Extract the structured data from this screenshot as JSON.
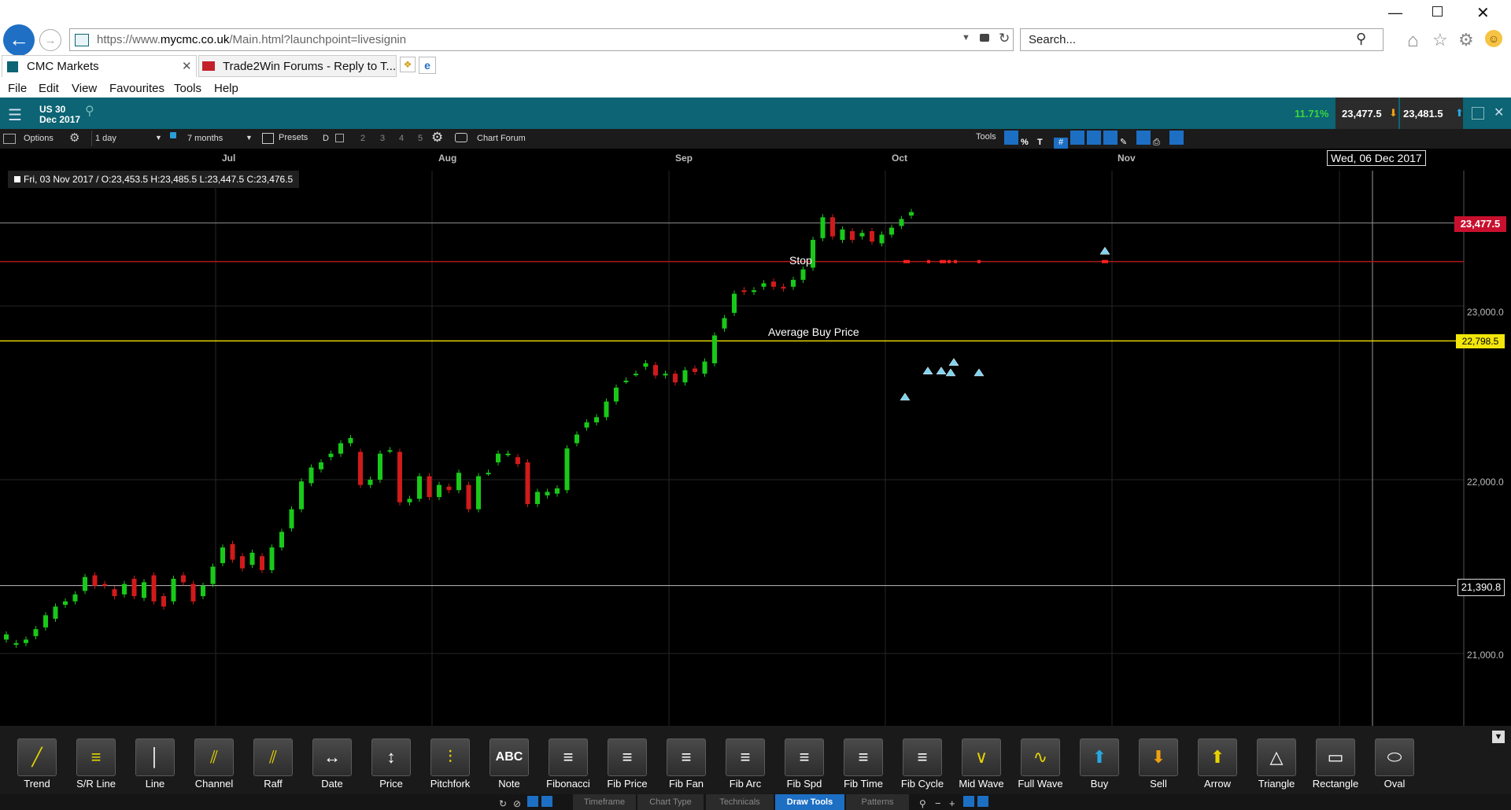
{
  "browser": {
    "url_prefix": "https://www.",
    "url_domain": "mycmc.co.uk",
    "url_path": "/Main.html?launchpoint=livesignin",
    "search_placeholder": "Search...",
    "tabs": [
      {
        "title": "CMC Markets",
        "active": true
      },
      {
        "title": "Trade2Win Forums - Reply to T...",
        "active": false
      }
    ],
    "menu": [
      "File",
      "Edit",
      "View",
      "Favourites",
      "Tools",
      "Help"
    ]
  },
  "instrument": {
    "name": "US 30",
    "expiry": "Dec 2017",
    "change_pct": "11.71%",
    "sell_price": "23,477.5",
    "buy_price": "23,481.5"
  },
  "options_bar": {
    "options_label": "Options",
    "interval": "1 day",
    "range": "7 months",
    "presets_label": "Presets",
    "d_label": "D",
    "preset_nums": [
      "2",
      "3",
      "4",
      "5"
    ],
    "chart_forum_label": "Chart Forum",
    "tools_label": "Tools"
  },
  "chart": {
    "months": [
      "Jul",
      "Aug",
      "Sep",
      "Oct",
      "Nov"
    ],
    "crosshair_date": "Wed, 06 Dec 2017",
    "ohlc_label": "Fri, 03 Nov 2017 / O:23,453.5  H:23,485.5  L:23,447.5  C:23,476.5",
    "price_ticks": [
      "23,000.0",
      "22,000.0",
      "21,000.0"
    ],
    "current_price_label": "23,477.5",
    "avg_price_label": "22,798.5",
    "cursor_price_label": "21,390.8",
    "stop_label": "Stop",
    "avg_label": "Average Buy Price",
    "colors": {
      "up": "#19c919",
      "down": "#d11a1a",
      "avg": "#e6d300",
      "stop": "#b01919",
      "current": "#c8102e"
    }
  },
  "chart_data": {
    "type": "candlestick",
    "ylim": [
      20600,
      23900
    ],
    "avg_buy": 22798.5,
    "stop": 23255,
    "current": 23477.5,
    "cursor": 21390.8,
    "candles": [
      [
        21080,
        21110
      ],
      [
        21050,
        21060
      ],
      [
        21060,
        21080
      ],
      [
        21100,
        21140
      ],
      [
        21150,
        21220
      ],
      [
        21200,
        21270
      ],
      [
        21280,
        21300
      ],
      [
        21300,
        21340
      ],
      [
        21360,
        21440
      ],
      [
        21450,
        21390
      ],
      [
        21400,
        21390
      ],
      [
        21370,
        21330
      ],
      [
        21340,
        21400
      ],
      [
        21430,
        21330
      ],
      [
        21320,
        21410
      ],
      [
        21450,
        21300
      ],
      [
        21330,
        21270
      ],
      [
        21300,
        21430
      ],
      [
        21450,
        21410
      ],
      [
        21400,
        21300
      ],
      [
        21330,
        21390
      ],
      [
        21400,
        21500
      ],
      [
        21520,
        21610
      ],
      [
        21630,
        21540
      ],
      [
        21560,
        21490
      ],
      [
        21510,
        21580
      ],
      [
        21560,
        21480
      ],
      [
        21480,
        21610
      ],
      [
        21610,
        21700
      ],
      [
        21720,
        21830
      ],
      [
        21830,
        21990
      ],
      [
        21980,
        22070
      ],
      [
        22060,
        22100
      ],
      [
        22130,
        22150
      ],
      [
        22150,
        22210
      ],
      [
        22210,
        22240
      ],
      [
        22160,
        21970
      ],
      [
        21970,
        22000
      ],
      [
        22000,
        22150
      ],
      [
        22170,
        22170
      ],
      [
        22160,
        21870
      ],
      [
        21870,
        21890
      ],
      [
        21890,
        22020
      ],
      [
        22020,
        21900
      ],
      [
        21900,
        21970
      ],
      [
        21960,
        21940
      ],
      [
        21940,
        22040
      ],
      [
        21970,
        21830
      ],
      [
        21830,
        22020
      ],
      [
        22040,
        22040
      ],
      [
        22100,
        22150
      ],
      [
        22150,
        22150
      ],
      [
        22130,
        22090
      ],
      [
        22100,
        21860
      ],
      [
        21860,
        21930
      ],
      [
        21910,
        21930
      ],
      [
        21920,
        21950
      ],
      [
        21940,
        22180
      ],
      [
        22210,
        22260
      ],
      [
        22300,
        22330
      ],
      [
        22330,
        22360
      ],
      [
        22360,
        22450
      ],
      [
        22450,
        22530
      ],
      [
        22570,
        22570
      ],
      [
        22610,
        22610
      ],
      [
        22650,
        22670
      ],
      [
        22660,
        22600
      ],
      [
        22600,
        22610
      ],
      [
        22610,
        22560
      ],
      [
        22560,
        22630
      ],
      [
        22640,
        22620
      ],
      [
        22610,
        22680
      ],
      [
        22670,
        22830
      ],
      [
        22870,
        22930
      ],
      [
        22960,
        23070
      ],
      [
        23090,
        23080
      ],
      [
        23080,
        23090
      ],
      [
        23110,
        23130
      ],
      [
        23140,
        23110
      ],
      [
        23110,
        23100
      ],
      [
        23110,
        23150
      ],
      [
        23150,
        23210
      ],
      [
        23220,
        23380
      ],
      [
        23390,
        23510
      ],
      [
        23510,
        23400
      ],
      [
        23380,
        23440
      ],
      [
        23430,
        23380
      ],
      [
        23400,
        23420
      ],
      [
        23430,
        23370
      ],
      [
        23360,
        23410
      ],
      [
        23410,
        23450
      ],
      [
        23460,
        23500
      ],
      [
        23520,
        23540
      ]
    ]
  },
  "draw_tools": [
    {
      "label": "Trend",
      "icon": "trend-line-icon"
    },
    {
      "label": "S/R Line",
      "icon": "sr-line-icon"
    },
    {
      "label": "Line",
      "icon": "vertical-line-icon"
    },
    {
      "label": "Channel",
      "icon": "channel-icon"
    },
    {
      "label": "Raff",
      "icon": "raff-icon"
    },
    {
      "label": "Date",
      "icon": "date-icon"
    },
    {
      "label": "Price",
      "icon": "price-icon"
    },
    {
      "label": "Pitchfork",
      "icon": "pitchfork-icon"
    },
    {
      "label": "Note",
      "icon": "note-icon",
      "glyph": "ABC"
    },
    {
      "label": "Fibonacci",
      "icon": "fibonacci-icon"
    },
    {
      "label": "Fib Price",
      "icon": "fib-price-icon"
    },
    {
      "label": "Fib Fan",
      "icon": "fib-fan-icon"
    },
    {
      "label": "Fib Arc",
      "icon": "fib-arc-icon"
    },
    {
      "label": "Fib Spd",
      "icon": "fib-speed-icon"
    },
    {
      "label": "Fib Time",
      "icon": "fib-time-icon"
    },
    {
      "label": "Fib Cycle",
      "icon": "fib-cycle-icon"
    },
    {
      "label": "Mid Wave",
      "icon": "mid-wave-icon"
    },
    {
      "label": "Full Wave",
      "icon": "full-wave-icon"
    },
    {
      "label": "Buy",
      "icon": "buy-arrow-icon"
    },
    {
      "label": "Sell",
      "icon": "sell-arrow-icon"
    },
    {
      "label": "Arrow",
      "icon": "arrow-icon"
    },
    {
      "label": "Triangle",
      "icon": "triangle-icon"
    },
    {
      "label": "Rectangle",
      "icon": "rectangle-icon"
    },
    {
      "label": "Oval",
      "icon": "oval-icon"
    }
  ],
  "bottom_tabs": [
    {
      "label": "Timeframe",
      "active": false
    },
    {
      "label": "Chart Type",
      "active": false
    },
    {
      "label": "Technicals",
      "active": false
    },
    {
      "label": "Draw Tools",
      "active": true
    },
    {
      "label": "Patterns",
      "active": false
    }
  ]
}
